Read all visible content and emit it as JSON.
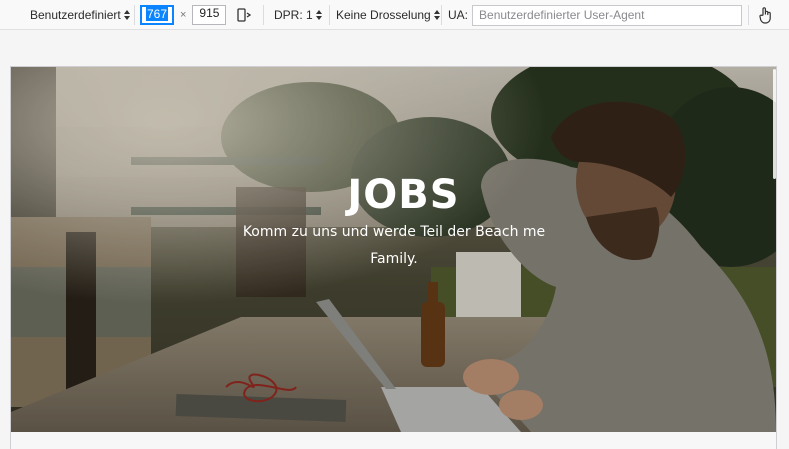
{
  "toolbar": {
    "device": "Benutzerdefiniert",
    "width": "767",
    "separator": "×",
    "height": "915",
    "dpr": "DPR: 1",
    "throttling": "Keine Drosselung",
    "ua_label": "UA:",
    "ua_placeholder": "Benutzerdefinierter User-Agent"
  },
  "hero": {
    "title": "JOBS",
    "subtitle": "Komm zu uns und werde Teil der Beach me Family."
  }
}
